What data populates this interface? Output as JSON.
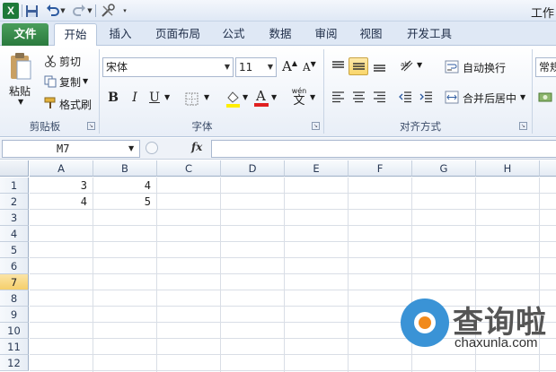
{
  "app": {
    "logo_letter": "X",
    "title": "工作"
  },
  "tabs": [
    "文件",
    "开始",
    "插入",
    "页面布局",
    "公式",
    "数据",
    "审阅",
    "视图",
    "开发工具"
  ],
  "clipboard": {
    "paste": "粘贴",
    "cut": "剪切",
    "copy": "复制",
    "format_painter": "格式刷",
    "group": "剪贴板"
  },
  "font": {
    "name": "宋体",
    "size": "11",
    "bold": "B",
    "italic": "I",
    "underline": "U",
    "group": "字体",
    "grow": "A",
    "shrink": "A",
    "color_letter": "A",
    "phonetic": "wén",
    "phonetic_char": "文"
  },
  "alignment": {
    "wrap": "自动换行",
    "merge": "合并后居中",
    "group": "对齐方式"
  },
  "number": {
    "format": "常规"
  },
  "formula_bar": {
    "name_box": "M7",
    "fx": "fx",
    "value": ""
  },
  "columns": [
    "A",
    "B",
    "C",
    "D",
    "E",
    "F",
    "G",
    "H"
  ],
  "rows": [
    "1",
    "2",
    "3",
    "4",
    "5",
    "6",
    "7",
    "8",
    "9",
    "10",
    "11",
    "12"
  ],
  "selected_row": "7",
  "cells": {
    "A1": "3",
    "B1": "4",
    "A2": "4",
    "B2": "5"
  },
  "colors": {
    "file_tab": "#2a7a3e",
    "fill_highlight": "#ffee00",
    "font_color": "#e02020"
  },
  "watermark": {
    "title": "查询啦",
    "subtitle": "chaxunla.com"
  }
}
